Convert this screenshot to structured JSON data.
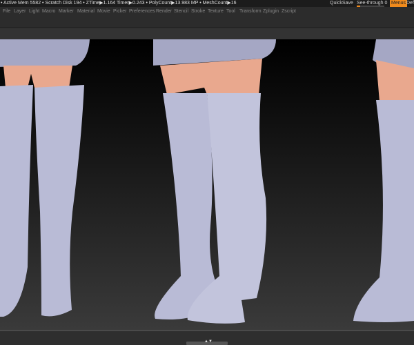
{
  "status": {
    "text": "• Active Mem 5582 • Scratch Disk 194 •  ZTime▶1.164 Timer▶0.243 • PolyCount▶13.983 MP  • MeshCount▶16",
    "quicksave": "QuickSave",
    "see_through": "See-through  0",
    "see_through_value": 0.1,
    "menus": "Menus",
    "default": "Defa"
  },
  "menu": [
    "File",
    "Layer",
    "Light",
    "Macro",
    "Marker",
    "Material",
    "Movie",
    "Picker",
    "Preferences",
    "Render",
    "Stencil",
    "Stroke",
    "Texture",
    "Tool",
    "Transform",
    "Zplugin",
    "Zscript"
  ],
  "bottom": {
    "toggle": "▲▼"
  },
  "colors": {
    "accent": "#f08a1c",
    "boot": "#b9bbd6",
    "skin": "#e9a88e",
    "sweater": "#a5a7c4"
  }
}
